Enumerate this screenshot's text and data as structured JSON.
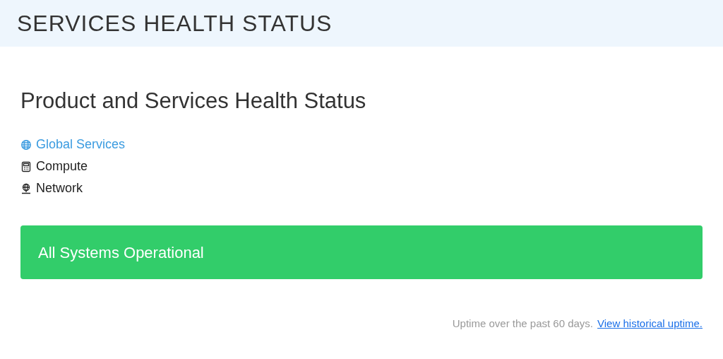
{
  "header": {
    "title": "SERVICES HEALTH STATUS"
  },
  "heading": "Product and Services Health Status",
  "nav": [
    {
      "label": "Global Services",
      "kind": "globe",
      "selected": true
    },
    {
      "label": "Compute",
      "kind": "calculator",
      "selected": false
    },
    {
      "label": "Network",
      "kind": "network",
      "selected": false
    }
  ],
  "status_banner": {
    "text": "All Systems Operational"
  },
  "footer": {
    "note": "Uptime over the past 60 days.",
    "link": "View historical uptime."
  }
}
